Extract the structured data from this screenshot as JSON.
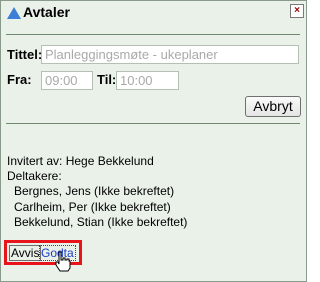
{
  "dialog": {
    "title": "Avtaler",
    "close_symbol": "×",
    "title_icon": "triangle-up-icon",
    "close_icon": "close-icon"
  },
  "form": {
    "title_label": "Tittel:",
    "title_value": "Planleggingsmøte - ukeplaner",
    "from_label": "Fra:",
    "from_value": "09:00",
    "to_label": "Til:",
    "to_value": "10:00",
    "cancel_label": "Avbryt"
  },
  "details": {
    "invited_by": "Invitert av: Hege Bekkelund",
    "participants_heading": "Deltakere:",
    "participants": [
      "Bergnes, Jens (Ikke bekreftet)",
      "Carlheim, Per (Ikke bekreftet)",
      "Bekkelund, Stian (Ikke bekreftet)"
    ]
  },
  "actions": {
    "decline_label": "Avvis",
    "accept_label": "Godta"
  },
  "colors": {
    "panel_bg": "#e9f1e9",
    "highlight_border": "#e8141c",
    "link_blue": "#1a3ec8"
  }
}
